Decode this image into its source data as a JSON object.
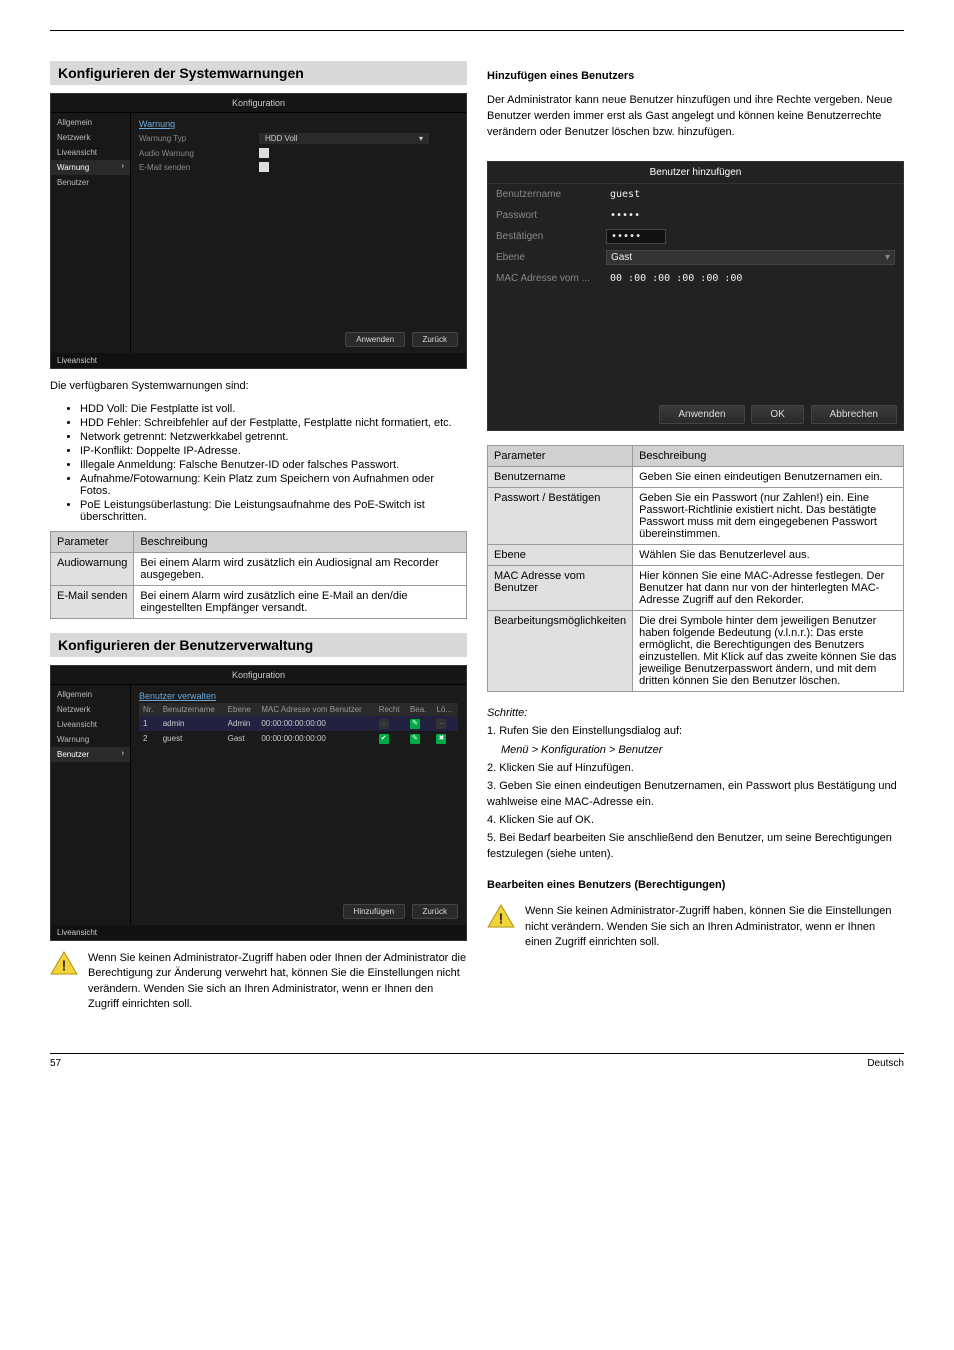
{
  "section": {
    "exceptions_title": "Konfigurieren der Systemwarnungen",
    "exceptions_intro": "Die verfügbaren Systemwarnungen sind:",
    "exceptions_list": [
      "HDD Voll: Die Festplatte ist voll.",
      "HDD Fehler: Schreibfehler auf der Festplatte, Festplatte nicht formatiert, etc.",
      "Network getrennt: Netzwerkkabel getrennt.",
      "IP-Konflikt: Doppelte IP-Adresse.",
      "Illegale Anmeldung: Falsche Benutzer-ID oder falsches Passwort.",
      "Aufnahme/Fotowarnung: Kein Platz zum Speichern von Aufnahmen oder Fotos.",
      "PoE Leistungsüberlastung: Die Leistungsaufnahme des PoE-Switch ist überschritten."
    ],
    "user_title": "Konfigurieren der Benutzerverwaltung",
    "add_user_header": "Hinzufügen eines Benutzers",
    "add_user_note": "Der Administrator kann neue Benutzer hinzufügen und ihre Rechte vergeben. Neue Benutzer werden immer erst als Gast angelegt und können keine Benutzerrechte verändern oder Benutzer löschen bzw. hinzufügen.",
    "edit_user_header": "Bearbeiten eines Benutzers (Berechtigungen)"
  },
  "screenshot1": {
    "title": "Konfiguration",
    "sidebar": [
      "Allgemein",
      "Netzwerk",
      "Liveansicht",
      "Warnung",
      "Benutzer"
    ],
    "link": "Warnung",
    "rows": [
      {
        "label": "Warnung Typ",
        "value": "HDD Voll"
      },
      {
        "label": "Audio Warnung",
        "check": true
      },
      {
        "label": "E-Mail senden",
        "check": true
      }
    ],
    "live_btn": "Liveansicht",
    "apply": "Anwenden",
    "back": "Zurück"
  },
  "screenshot2": {
    "title": "Konfiguration",
    "sidebar": [
      "Allgemein",
      "Netzwerk",
      "Liveansicht",
      "Warnung",
      "Benutzer"
    ],
    "link": "Benutzer verwalten",
    "headers": [
      "Nr.",
      "Benutzername",
      "Ebene",
      "MAC Adresse vom Benutzer",
      "Recht",
      "Bea.",
      "Lö..."
    ],
    "rows": [
      {
        "nr": "1",
        "user": "admin",
        "lvl": "Admin",
        "mac": "00:00:00:00:00:00",
        "rDisabled": true
      },
      {
        "nr": "2",
        "user": "guest",
        "lvl": "Gast",
        "mac": "00:00:00:00:00:00",
        "rDisabled": false
      }
    ],
    "live_btn": "Liveansicht",
    "add": "Hinzufügen",
    "back": "Zurück"
  },
  "dialog": {
    "title": "Benutzer hinzufügen",
    "rows": {
      "user_label": "Benutzername",
      "user_val": "guest",
      "pw_label": "Passwort",
      "pw_val": "•••••",
      "confirm_label": "Bestätigen",
      "confirm_val": "•••••",
      "level_label": "Ebene",
      "level_val": "Gast",
      "mac_label": "MAC Adresse vom ...",
      "mac_val": "00 :00 :00 :00 :00 :00"
    },
    "apply": "Anwenden",
    "ok": "OK",
    "cancel": "Abbrechen"
  },
  "table1": {
    "head": [
      "Parameter",
      "Beschreibung"
    ],
    "rows": [
      {
        "p": "Audiowarnung",
        "d": "Bei einem Alarm wird zusätzlich ein Audiosignal am Recorder ausgegeben."
      },
      {
        "p": "E-Mail senden",
        "d": "Bei einem Alarm wird zusätzlich eine E-Mail an den/die eingestellten Empfänger versandt."
      }
    ]
  },
  "table2": {
    "head": [
      "Parameter",
      "Beschreibung"
    ],
    "rows": [
      {
        "p": "Benutzername",
        "d": "Geben Sie einen eindeutigen Benutzernamen ein."
      },
      {
        "p": "Passwort / Bestätigen",
        "d": "Geben Sie ein Passwort (nur Zahlen!) ein. Eine Passwort-Richtlinie existiert nicht. Das bestätigte Passwort muss mit dem eingegebenen Passwort übereinstimmen."
      },
      {
        "p": "Ebene",
        "d": "Wählen Sie das Benutzerlevel aus."
      },
      {
        "p": "MAC Adresse vom Benutzer",
        "d": "Hier können Sie eine MAC-Adresse festlegen. Der Benutzer hat dann nur von der hinterlegten MAC-Adresse Zugriff auf den Rekorder."
      },
      {
        "p": "Bearbeitungsmöglichkeiten",
        "d": "Die drei Symbole hinter dem jeweiligen Benutzer haben folgende Bedeutung (v.l.n.r.): Das erste ermöglicht, die Berechtigungen des Benutzers einzustellen. Mit Klick auf das zweite können Sie das jeweilige Benutzerpasswort ändern, und mit dem dritten können Sie den Benutzer löschen."
      }
    ]
  },
  "notes": {
    "n1": "Wenn Sie keinen Administrator-Zugriff haben oder Ihnen der Administrator die Berechtigung zur Änderung verwehrt hat, können Sie die Einstellungen nicht verändern. Wenden Sie sich an Ihren Administrator, wenn er Ihnen den Zugriff einrichten soll.",
    "n2": "Wenn Sie keinen Administrator-Zugriff haben, können Sie die Einstellungen nicht verändern. Wenden Sie sich an Ihren Administrator, wenn er Ihnen einen Zugriff einrichten soll."
  },
  "steps": {
    "s0": "Schritte:",
    "s1": "Rufen Sie den Einstellungsdialog auf:",
    "s1a": "Menü > Konfiguration > Benutzer",
    "s2": "Klicken Sie auf Hinzufügen.",
    "s3": "Geben Sie einen eindeutigen Benutzernamen, ein Passwort plus Bestätigung und wahlweise eine MAC-Adresse ein.",
    "s4": "Klicken Sie auf OK.",
    "s5": "Bei Bedarf bearbeiten Sie anschließend den Benutzer, um seine Berechtigungen festzulegen (siehe unten)."
  },
  "footer": {
    "left": "57",
    "right": "Deutsch"
  }
}
